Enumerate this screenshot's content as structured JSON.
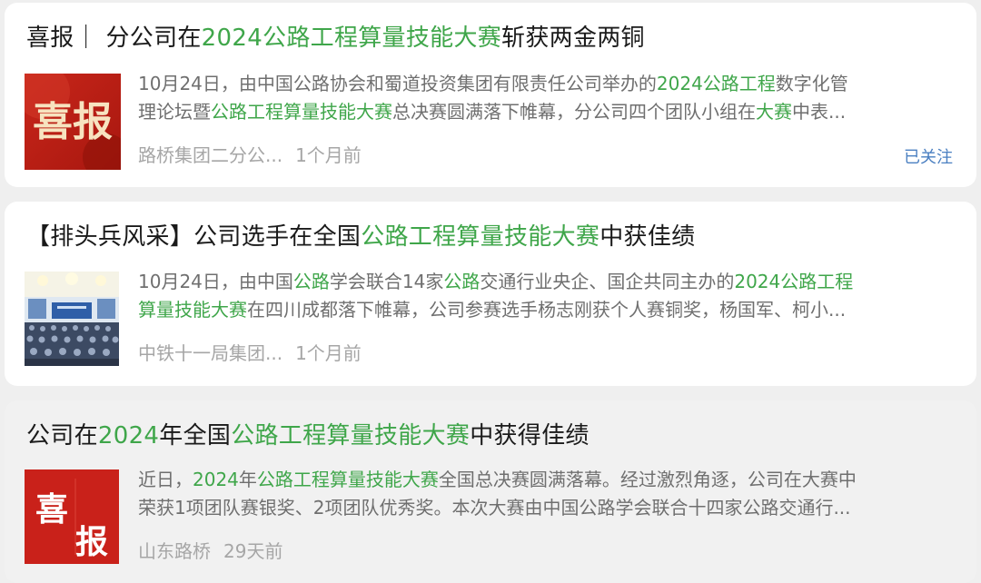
{
  "results": [
    {
      "title": [
        {
          "t": "喜报｜ 分公司在"
        },
        {
          "t": "2024公路工程算量技能大赛",
          "hl": true
        },
        {
          "t": "斩获两金两铜"
        }
      ],
      "thumb": {
        "type": "xibao-calligraphy",
        "text": "喜报"
      },
      "excerpt_lines": [
        [
          {
            "t": "10月24日，由中国公路协会和蜀道投资集团有限责任公司举办的"
          },
          {
            "t": "2024公路工程",
            "hl": true
          },
          {
            "t": "数字化管"
          }
        ],
        [
          {
            "t": "理论坛暨"
          },
          {
            "t": "公路工程算量技能大赛",
            "hl": true
          },
          {
            "t": "总决赛圆满落下帷幕，分公司四个团队小组在"
          },
          {
            "t": "大赛",
            "hl": true
          },
          {
            "t": "中表..."
          }
        ]
      ],
      "source": "路桥集团二分公...",
      "time": "1个月前",
      "follow": "已关注"
    },
    {
      "title": [
        {
          "t": "【排头兵风采】公司选手在全国"
        },
        {
          "t": "公路工程算量技能大赛",
          "hl": true
        },
        {
          "t": "中获佳绩"
        }
      ],
      "thumb": {
        "type": "conference-photo"
      },
      "excerpt_lines": [
        [
          {
            "t": "10月24日，由中国"
          },
          {
            "t": "公路",
            "hl": true
          },
          {
            "t": "学会联合14家"
          },
          {
            "t": "公路",
            "hl": true
          },
          {
            "t": "交通行业央企、国企共同主办的"
          },
          {
            "t": "2024公路工程",
            "hl": true
          }
        ],
        [
          {
            "t": "算量技能大赛",
            "hl": true
          },
          {
            "t": "在四川成都落下帷幕，公司参赛选手杨志刚获个人赛铜奖，杨国军、柯小..."
          }
        ]
      ],
      "source": "中铁十一局集团...",
      "time": "1个月前"
    },
    {
      "title": [
        {
          "t": "公司在"
        },
        {
          "t": "2024",
          "hl": true
        },
        {
          "t": "年全国"
        },
        {
          "t": "公路工程算量技能大赛",
          "hl": true
        },
        {
          "t": "中获得佳绩"
        }
      ],
      "thumb": {
        "type": "xibao-block",
        "chars": [
          "喜",
          "报"
        ]
      },
      "excerpt_lines": [
        [
          {
            "t": "近日，"
          },
          {
            "t": "2024",
            "hl": true
          },
          {
            "t": "年"
          },
          {
            "t": "公路工程算量技能大赛",
            "hl": true
          },
          {
            "t": "全国总决赛圆满落幕。经过激烈角逐，公司在大赛中"
          }
        ],
        [
          {
            "t": "荣获1项团队赛银奖、2项团队优秀奖。本次大赛由中国公路学会联合十四家公路交通行..."
          }
        ]
      ],
      "source": "山东路桥",
      "time": "29天前"
    }
  ],
  "colors": {
    "highlight": "#3fa64a",
    "follow": "#4a7fc1",
    "meta": "#a6a6a6",
    "excerpt": "#6f6f6f"
  }
}
